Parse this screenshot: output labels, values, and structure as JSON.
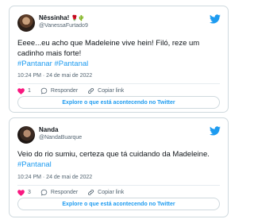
{
  "tweets": [
    {
      "name": "Nêssinha!",
      "name_emoji": "🌹🌵",
      "handle": "@VanessaFurtado9",
      "text": "Eeee...eu acho que Madeleine vive hein! Filó, reze um cadinho mais forte!",
      "hashtags": "#Pantanar #Pantanal",
      "timestamp": "10:24 PM · 24 de mai de 2022",
      "likes": "1",
      "reply_label": "Responder",
      "copy_label": "Copiar link",
      "explore_label": "Explore o que está acontecendo no Twitter"
    },
    {
      "name": "Nanda",
      "handle": "@NandaBuarque",
      "text": "Veio do rio sumiu, certeza que tá cuidando da Madeleine.",
      "hashtags": "#Pantanal",
      "timestamp": "10:24 PM · 24 de mai de 2022",
      "likes": "3",
      "reply_label": "Responder",
      "copy_label": "Copiar link",
      "explore_label": "Explore o que está acontecendo no Twitter"
    }
  ],
  "colors": {
    "accent": "#1d9bf0",
    "heart": "#f91880",
    "muted": "#536471"
  },
  "icons": [
    "twitter-bird-icon",
    "heart-icon",
    "reply-icon",
    "link-icon"
  ]
}
